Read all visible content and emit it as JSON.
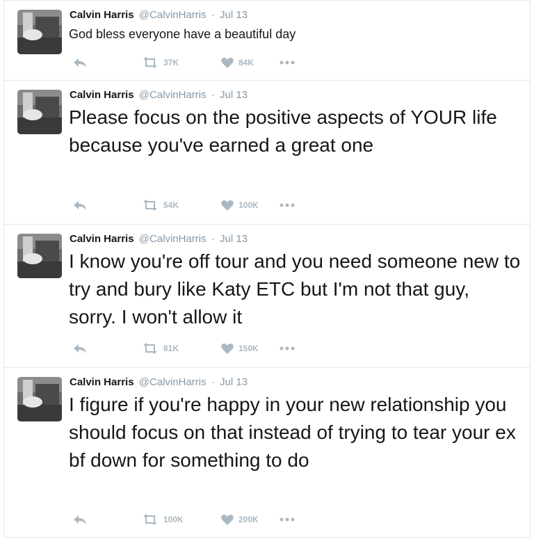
{
  "tweets": [
    {
      "author": "Calvin Harris",
      "handle": "@CalvinHarris",
      "separator": "·",
      "date": "Jul 13",
      "text": "God bless everyone have a beautiful day",
      "retweets": "37K",
      "likes": "84K"
    },
    {
      "author": "Calvin Harris",
      "handle": "@CalvinHarris",
      "separator": "·",
      "date": "Jul 13",
      "text": "Please focus on the positive aspects of YOUR life because you've earned a great one",
      "retweets": "54K",
      "likes": "100K"
    },
    {
      "author": "Calvin Harris",
      "handle": "@CalvinHarris",
      "separator": "·",
      "date": "Jul 13",
      "text": "I know you're off tour and you need someone new to try and bury like Katy ETC but I'm not that guy, sorry. I won't allow it",
      "retweets": "81K",
      "likes": "150K"
    },
    {
      "author": "Calvin Harris",
      "handle": "@CalvinHarris",
      "separator": "·",
      "date": "Jul 13",
      "text": "I figure if you're happy in your new relationship you should focus on that instead of trying to tear your ex bf down for something to do",
      "retweets": "100K",
      "likes": "200K"
    }
  ],
  "icons": {
    "reply": "reply-icon",
    "retweet": "retweet-icon",
    "like": "heart-icon",
    "more": "more-dots-icon"
  },
  "colors": {
    "text": "#14171a",
    "muted": "#8899a6",
    "icon": "#aab8c2",
    "border": "#e1e8ed"
  }
}
